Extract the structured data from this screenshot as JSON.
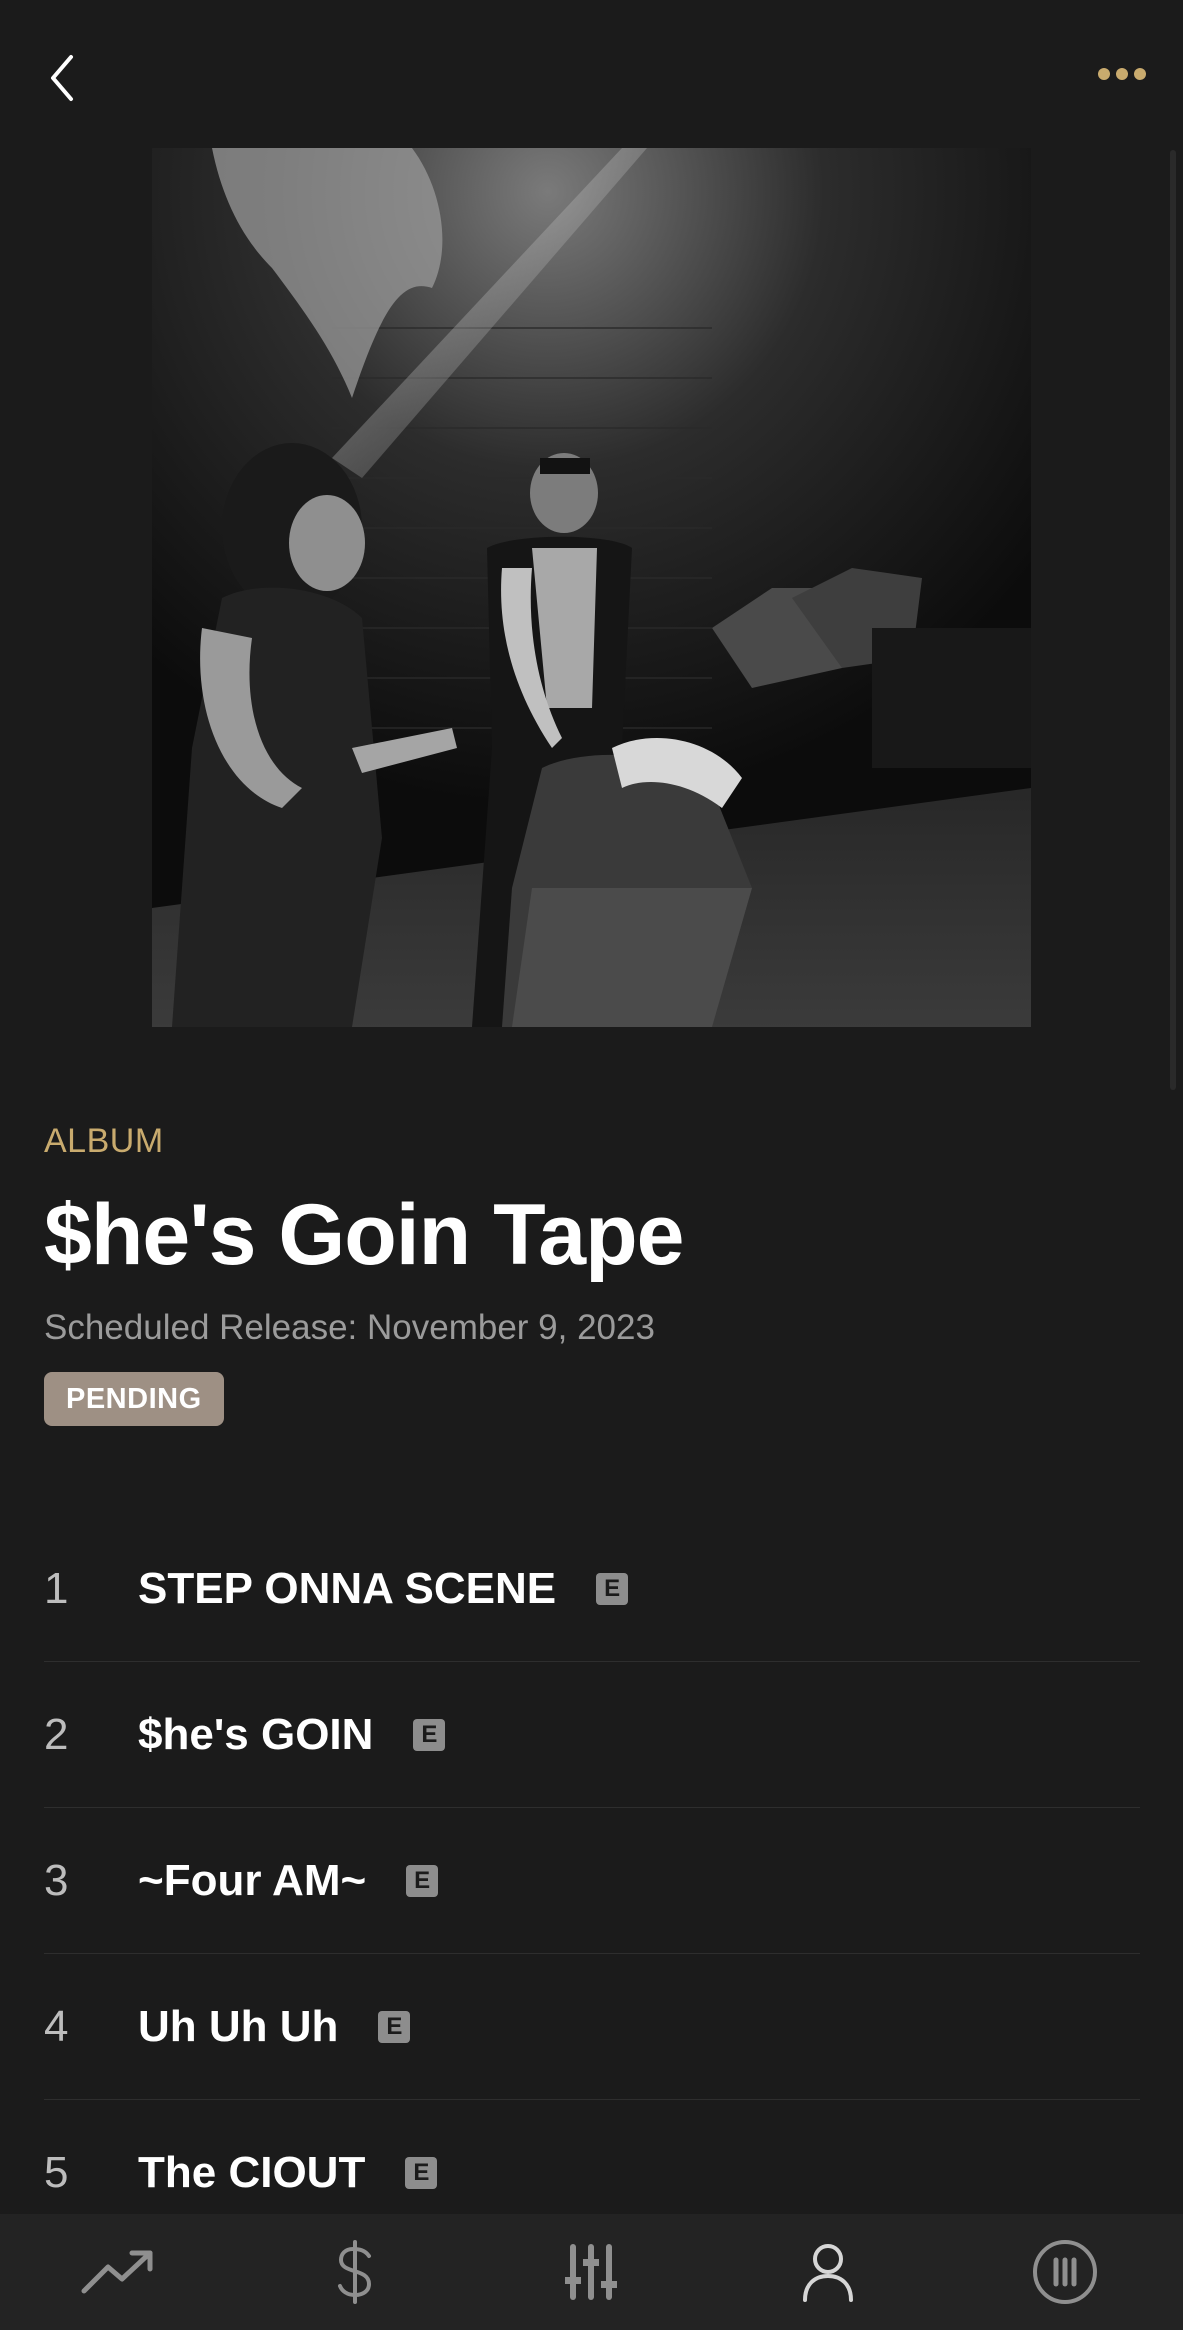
{
  "header": {
    "back_icon": "chevron-left-icon",
    "more_icon": "more-horizontal-icon",
    "accent_color": "#c9ab6e"
  },
  "release": {
    "kind": "ALBUM",
    "title": "$he's Goin Tape",
    "scheduled": "Scheduled Release: November 9, 2023",
    "status": "PENDING"
  },
  "tracks": [
    {
      "number": "1",
      "name": "STEP ONNA SCENE",
      "explicit": "E"
    },
    {
      "number": "2",
      "name": "$he's GOIN",
      "explicit": "E"
    },
    {
      "number": "3",
      "name": "~Four AM~",
      "explicit": "E"
    },
    {
      "number": "4",
      "name": "Uh Uh Uh",
      "explicit": "E"
    },
    {
      "number": "5",
      "name": "The CIOUT",
      "explicit": "E"
    }
  ],
  "bottom_nav": [
    {
      "icon": "trending-up-icon"
    },
    {
      "icon": "dollar-icon"
    },
    {
      "icon": "sliders-icon"
    },
    {
      "icon": "user-icon"
    },
    {
      "icon": "pause-circle-icon"
    }
  ]
}
